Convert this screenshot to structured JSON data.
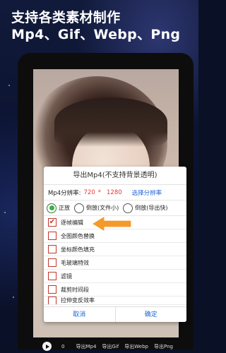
{
  "headline": {
    "line1": "支持各类素材制作",
    "line2": "Mp4、Gif、Webp、Png"
  },
  "dialog": {
    "title": "导出Mp4(不支持背景透明)",
    "resolution": {
      "label": "Mp4分辨率:",
      "width": "720",
      "x": "*",
      "height": "1280",
      "select_label": "选择分辨率"
    },
    "orientation": {
      "options": [
        {
          "label": "正放",
          "selected": true
        },
        {
          "label": "倒放(文件小)",
          "selected": false
        },
        {
          "label": "倒放(导出快)",
          "selected": false
        }
      ]
    },
    "options": [
      {
        "label": "逐帧编辑",
        "checked": true
      },
      {
        "label": "全图颜色替换",
        "checked": false
      },
      {
        "label": "坐标颜色填充",
        "checked": false
      },
      {
        "label": "毛玻璃特效",
        "checked": false
      },
      {
        "label": "滤镜",
        "checked": false
      },
      {
        "label": "裁剪时间段",
        "checked": false
      },
      {
        "label": "拉伸变反效率",
        "checked": false
      }
    ],
    "cancel_label": "取消",
    "confirm_label": "确定"
  },
  "toolbar": {
    "time": "0",
    "items": [
      "导出Mp4",
      "导出Gif",
      "导出Webp",
      "导出Png"
    ]
  },
  "colors": {
    "accent_blue": "#1e66d0",
    "highlight_red": "#e53935",
    "arrow_orange": "#f39a2b",
    "radio_green": "#3cb043"
  }
}
